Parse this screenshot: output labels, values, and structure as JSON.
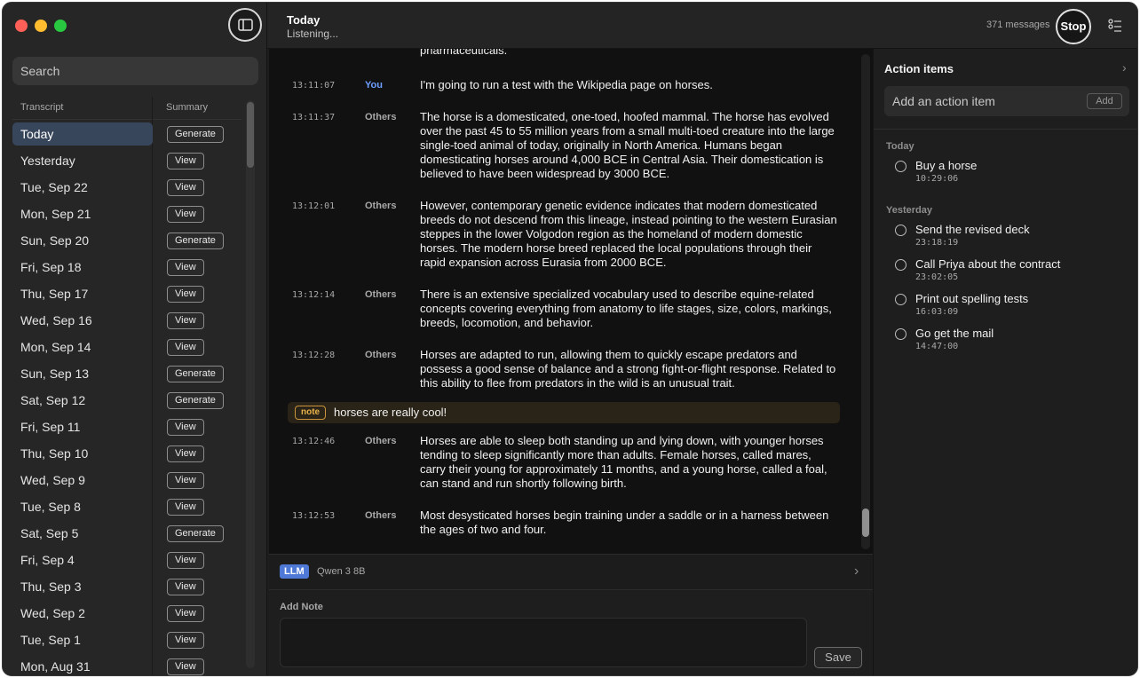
{
  "header": {
    "title": "Today",
    "subtitle": "Listening...",
    "message_count": "371 messages",
    "stop_label": "Stop"
  },
  "sidebar": {
    "search_placeholder": "Search",
    "col_transcript": "Transcript",
    "col_summary": "Summary",
    "days": [
      {
        "label": "Today",
        "action": "Generate"
      },
      {
        "label": "Yesterday",
        "action": "View"
      },
      {
        "label": "Tue, Sep 22",
        "action": "View"
      },
      {
        "label": "Mon, Sep 21",
        "action": "View"
      },
      {
        "label": "Sun, Sep 20",
        "action": "Generate"
      },
      {
        "label": "Fri, Sep 18",
        "action": "View"
      },
      {
        "label": "Thu, Sep 17",
        "action": "View"
      },
      {
        "label": "Wed, Sep 16",
        "action": "View"
      },
      {
        "label": "Mon, Sep 14",
        "action": "View"
      },
      {
        "label": "Sun, Sep 13",
        "action": "Generate"
      },
      {
        "label": "Sat, Sep 12",
        "action": "Generate"
      },
      {
        "label": "Fri, Sep 11",
        "action": "View"
      },
      {
        "label": "Thu, Sep 10",
        "action": "View"
      },
      {
        "label": "Wed, Sep 9",
        "action": "View"
      },
      {
        "label": "Tue, Sep 8",
        "action": "View"
      },
      {
        "label": "Sat, Sep 5",
        "action": "Generate"
      },
      {
        "label": "Fri, Sep 4",
        "action": "View"
      },
      {
        "label": "Thu, Sep 3",
        "action": "View"
      },
      {
        "label": "Wed, Sep 2",
        "action": "View"
      },
      {
        "label": "Tue, Sep 1",
        "action": "View"
      },
      {
        "label": "Mon, Aug 31",
        "action": "View"
      }
    ]
  },
  "transcript": {
    "clipped_text": "pharmaceuticals.",
    "entries": [
      {
        "time": "13:11:07",
        "speaker": "You",
        "text": "I'm going to run a test with the Wikipedia page on horses."
      },
      {
        "time": "13:11:37",
        "speaker": "Others",
        "text": "The horse is a domesticated, one-toed, hoofed mammal. The horse has evolved over the past 45 to 55 million years from a small multi-toed creature into the large single-toed animal of today, originally in North America. Humans began domesticating horses around 4,000 BCE in Central Asia. Their domestication is believed to have been widespread by 3000 BCE."
      },
      {
        "time": "13:12:01",
        "speaker": "Others",
        "text": "However, contemporary genetic evidence indicates that modern domesticated breeds do not descend from this lineage, instead pointing to the western Eurasian steppes in the lower Volgodon region as the homeland of modern domestic horses. The modern horse breed replaced the local populations through their rapid expansion across Eurasia from 2000 BCE."
      },
      {
        "time": "13:12:14",
        "speaker": "Others",
        "text": "There is an extensive specialized vocabulary used to describe equine-related concepts covering everything from anatomy to life stages, size, colors, markings, breeds, locomotion, and behavior."
      },
      {
        "time": "13:12:28",
        "speaker": "Others",
        "text": "Horses are adapted to run, allowing them to quickly escape predators and possess a good sense of balance and a strong fight-or-flight response. Related to this ability to flee from predators in the wild is an unusual trait."
      },
      {
        "time": "13:12:46",
        "speaker": "Others",
        "text": "Horses are able to sleep both standing up and lying down, with younger horses tending to sleep significantly more than adults. Female horses, called mares, carry their young for approximately 11 months, and a young horse, called a foal, can stand and run shortly following birth."
      },
      {
        "time": "13:12:53",
        "speaker": "Others",
        "text": "Most desysticated horses begin training under a saddle or in a harness between the ages of two and four."
      }
    ],
    "note": {
      "tag": "note",
      "text": "horses are really cool!"
    }
  },
  "llm": {
    "badge": "LLM",
    "model": "Qwen 3 8B"
  },
  "note_area": {
    "label": "Add Note",
    "save_label": "Save"
  },
  "action_items": {
    "title": "Action items",
    "input_placeholder": "Add an action item",
    "add_label": "Add",
    "groups": [
      {
        "label": "Today",
        "items": [
          {
            "label": "Buy a horse",
            "time": "10:29:06"
          }
        ]
      },
      {
        "label": "Yesterday",
        "items": [
          {
            "label": "Send the revised deck",
            "time": "23:18:19"
          },
          {
            "label": "Call Priya about the contract",
            "time": "23:02:05"
          },
          {
            "label": "Print out spelling tests",
            "time": "16:03:09"
          },
          {
            "label": "Go get the mail",
            "time": "14:47:00"
          }
        ]
      }
    ]
  },
  "colors": {
    "accent": "#4e79d6",
    "you_speaker": "#6e9eff",
    "selected_row": "#38465c",
    "note_tag": "#e8b24a"
  }
}
